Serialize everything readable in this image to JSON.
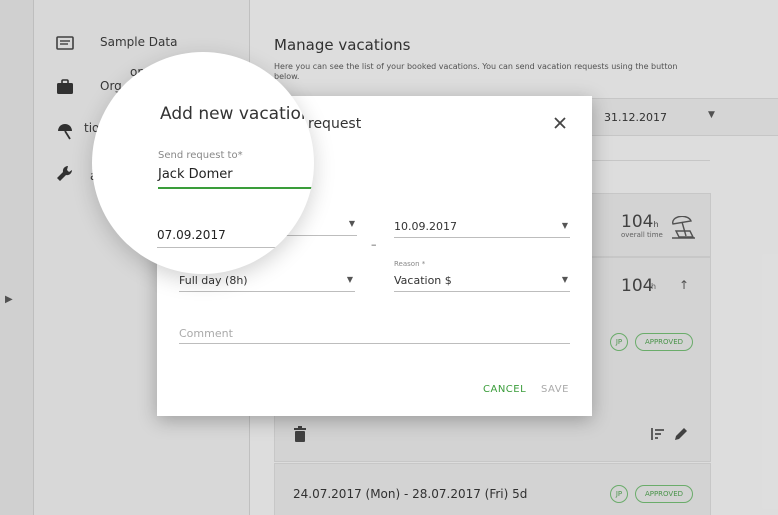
{
  "sidebar": {
    "items": [
      {
        "label": "Sample Data",
        "icon": "calendar-list-icon"
      },
      {
        "label": "on details",
        "icon": "briefcase-icon"
      },
      {
        "label": "tions",
        "icon": "beach-umbrella-icon"
      },
      {
        "label": "anced",
        "icon": "wrench-icon"
      }
    ],
    "partial_label_2": "Org"
  },
  "main": {
    "title": "Manage vacations",
    "description": "Here you can see the list of your booked vacations. You can send vacation requests using the button below.",
    "filter_end_date": "31.12.2017",
    "stat1": {
      "value": "104",
      "unit": "h",
      "caption": "overall time"
    },
    "stat2": {
      "value": "104",
      "unit": "h"
    },
    "badge_initials": "JP",
    "badge_status": "APPROVED",
    "row3_date": "24.07.2017 (Mon) - 28.07.2017 (Fri) 5d"
  },
  "dialog": {
    "title_partial": "request",
    "send_to_label": "Send request to*",
    "send_to_value": "Jack Domer",
    "date_from": "07.09.2017",
    "date_separator": "–",
    "date_to": "10.09.2017",
    "duration_value": "Full day (8h)",
    "reason_label": "Reason *",
    "reason_value": "Vacation $",
    "comment_placeholder": "Comment",
    "cancel_label": "CANCEL",
    "save_label": "SAVE"
  },
  "lens": {
    "title": "Add new vacation",
    "label": "Send request to*",
    "value": "Jack Domer",
    "date": "07.09.2017"
  },
  "colors": {
    "accent": "#3a9d3a",
    "badge": "#6fb36f"
  }
}
